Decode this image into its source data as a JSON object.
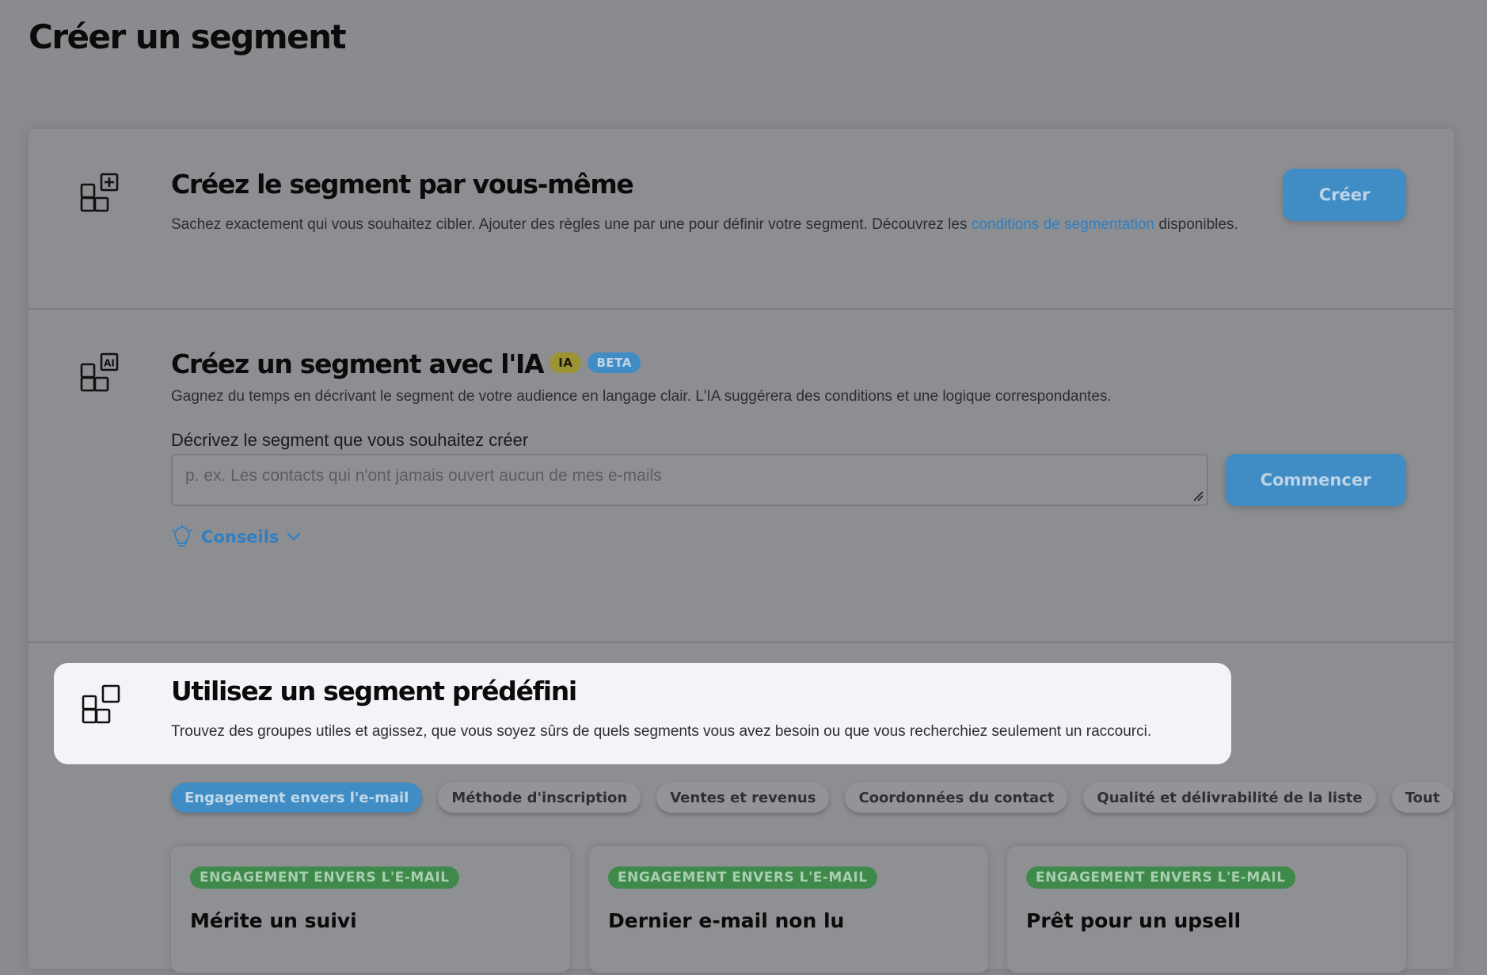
{
  "page": {
    "title": "Créer un segment"
  },
  "manual": {
    "title": "Créez le segment par vous-même",
    "desc_before": "Sachez exactement qui vous souhaitez cibler. Ajouter des règles une par une pour définir votre segment. Découvrez les ",
    "link": "conditions de segmentation",
    "desc_after": " disponibles.",
    "button": "Créer"
  },
  "ai": {
    "title": "Créez un segment avec l'IA",
    "badge_ia": "IA",
    "badge_beta": "BETA",
    "desc": "Gagnez du temps en décrivant le segment de votre audience en langage clair. L'IA suggérera des conditions et une logique correspondantes.",
    "field_label": "Décrivez le segment que vous souhaitez créer",
    "placeholder": "p. ex. Les contacts qui n'ont jamais ouvert aucun de mes e-mails",
    "button": "Commencer",
    "tips": "Conseils"
  },
  "predefined": {
    "title": "Utilisez un segment prédéfini",
    "desc": "Trouvez des groupes utiles et agissez, que vous soyez sûrs de quels segments vous avez besoin ou que vous recherchiez seulement un raccourci.",
    "chips": [
      {
        "label": "Engagement envers l'e-mail",
        "active": true
      },
      {
        "label": "Méthode d'inscription",
        "active": false
      },
      {
        "label": "Ventes et revenus",
        "active": false
      },
      {
        "label": "Coordonnées du contact",
        "active": false
      },
      {
        "label": "Qualité et délivrabilité de la liste",
        "active": false
      },
      {
        "label": "Tout",
        "active": false
      }
    ],
    "cards": [
      {
        "tag": "ENGAGEMENT ENVERS L'E-MAIL",
        "title": "Mérite un suivi"
      },
      {
        "tag": "ENGAGEMENT ENVERS L'E-MAIL",
        "title": "Dernier e-mail non lu"
      },
      {
        "tag": "ENGAGEMENT ENVERS L'E-MAIL",
        "title": "Prêt pour un upsell"
      }
    ]
  },
  "icons": {
    "manual": "segment-add-icon",
    "ai": "segment-ai-icon",
    "predefined": "segment-predefined-icon",
    "tips": "lightbulb-icon",
    "chevron": "chevron-down-icon",
    "resize": "resize-handle-icon"
  },
  "colors": {
    "accent": "#3f8dc4",
    "link": "#2f7fc4",
    "badge_ia": "#9c9332",
    "tag_green": "#3f8a4a",
    "highlight_bg": "#f3f4f7"
  }
}
